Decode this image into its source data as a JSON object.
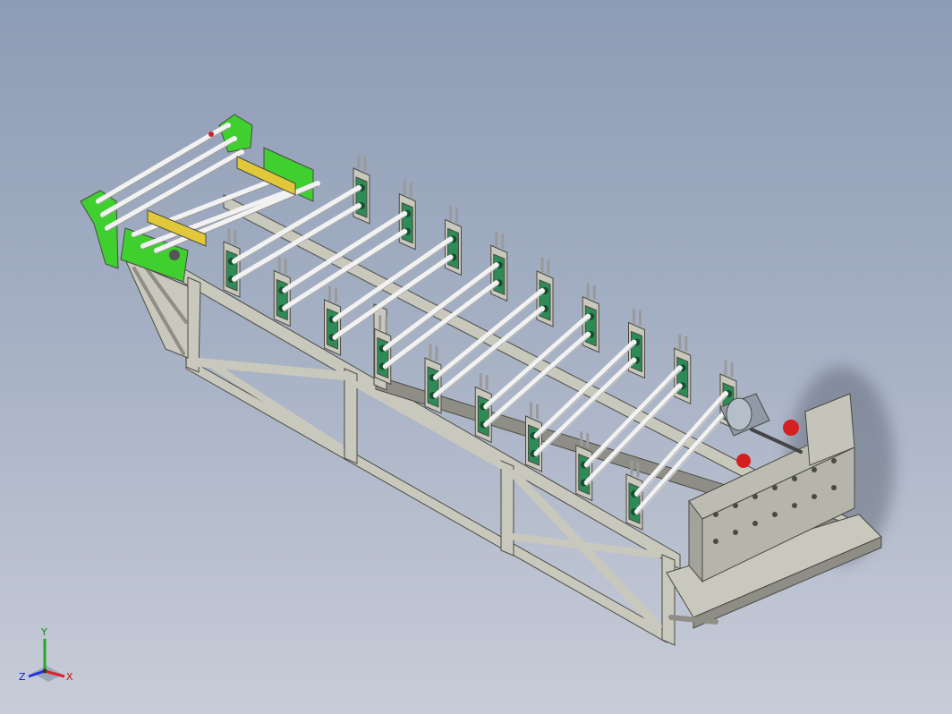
{
  "viewport": {
    "model": "roll-forming-machine",
    "background_top": "#8d9cb5",
    "background_bottom": "#c8ccd8",
    "colors": {
      "frame": "#c9c8bd",
      "frame_dark": "#8f8e86",
      "stand_green": "#2e8b57",
      "decoiler_green": "#3fcf2f",
      "roller_white": "#f2f2f2",
      "yellow_block": "#e0c83a",
      "motor": "#8f9aa6",
      "accent_red": "#d42020"
    },
    "roller_stand_count": 18
  },
  "triad": {
    "x_label": "X",
    "y_label": "Y",
    "z_label": "Z",
    "x_color": "#e0202a",
    "y_color": "#22aa22",
    "z_color": "#2233dd"
  }
}
